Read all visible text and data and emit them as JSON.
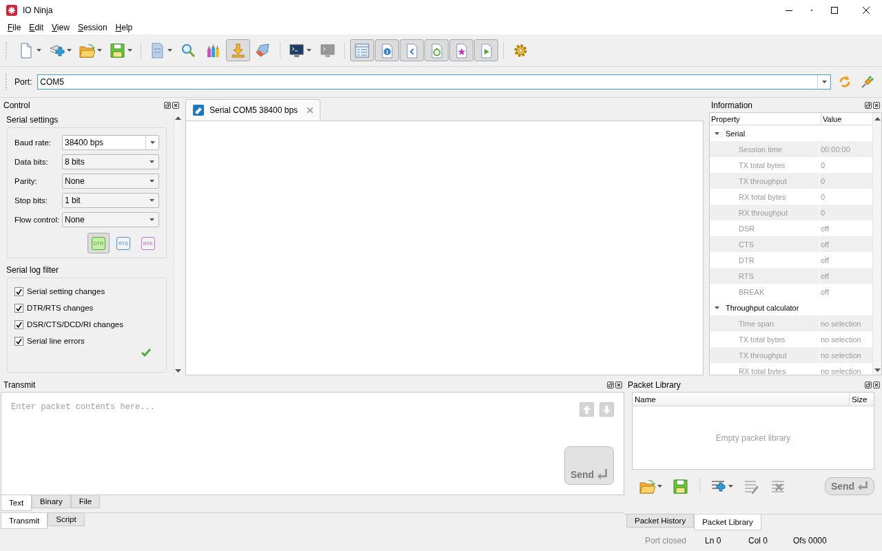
{
  "window": {
    "title": "IO Ninja"
  },
  "menu": [
    "File",
    "Edit",
    "View",
    "Session",
    "Help"
  ],
  "toolbar": [
    [
      {
        "dropdown": true,
        "pressed": false
      },
      {
        "dropdown": true,
        "pressed": false
      },
      {
        "dropdown": true,
        "pressed": false
      },
      {
        "dropdown": true,
        "pressed": false
      }
    ],
    [
      {
        "dropdown": true,
        "pressed": false
      },
      {
        "dropdown": false,
        "pressed": false
      },
      {
        "dropdown": false,
        "pressed": false
      },
      {
        "dropdown": false,
        "pressed": true
      },
      {
        "dropdown": false,
        "pressed": false
      }
    ],
    [
      {
        "dropdown": true,
        "pressed": false
      },
      {
        "dropdown": false,
        "pressed": false
      }
    ],
    [
      {
        "dropdown": false,
        "pressed": true
      },
      {
        "dropdown": false,
        "pressed": true
      },
      {
        "dropdown": false,
        "pressed": true
      },
      {
        "dropdown": false,
        "pressed": true
      },
      {
        "dropdown": false,
        "pressed": true
      },
      {
        "dropdown": false,
        "pressed": true
      }
    ],
    [
      {
        "dropdown": false,
        "pressed": false
      }
    ]
  ],
  "port": {
    "label": "Port:",
    "value": "COM5"
  },
  "control": {
    "title": "Control",
    "serial_settings": {
      "title": "Serial settings",
      "fields": [
        {
          "label": "Baud rate:",
          "value": "38400 bps",
          "kind": "editable"
        },
        {
          "label": "Data bits:",
          "value": "8 bits",
          "kind": "select"
        },
        {
          "label": "Parity:",
          "value": "None",
          "kind": "select"
        },
        {
          "label": "Stop bits:",
          "value": "1 bit",
          "kind": "select"
        },
        {
          "label": "Flow control:",
          "value": "None",
          "kind": "select"
        }
      ],
      "line_buttons": [
        {
          "label": "DTR",
          "pressed": true,
          "color": "#4caf1c"
        },
        {
          "label": "RTS",
          "pressed": false,
          "color": "#4a90d9"
        },
        {
          "label": "BRK",
          "pressed": false,
          "color": "#c470c8"
        }
      ]
    },
    "log_filter": {
      "title": "Serial log filter",
      "items": [
        {
          "label": "Serial setting changes",
          "checked": true
        },
        {
          "label": "DTR/RTS changes",
          "checked": true
        },
        {
          "label": "DSR/CTS/DCD/RI changes",
          "checked": true
        },
        {
          "label": "Serial line errors",
          "checked": true
        }
      ]
    }
  },
  "session_tabs": [
    {
      "label": "Serial COM5 38400 bps",
      "selected": true
    }
  ],
  "information": {
    "title": "Information",
    "columns": [
      "Property",
      "Value"
    ],
    "groups": [
      {
        "label": "Serial",
        "expanded": true,
        "children": [
          {
            "property": "Session time",
            "value": "00:00:00"
          },
          {
            "property": "TX total bytes",
            "value": "0"
          },
          {
            "property": "TX throughput",
            "value": "0"
          },
          {
            "property": "RX total bytes",
            "value": "0"
          },
          {
            "property": "RX throughput",
            "value": "0"
          },
          {
            "property": "DSR",
            "value": "off"
          },
          {
            "property": "CTS",
            "value": "off"
          },
          {
            "property": "DTR",
            "value": "off"
          },
          {
            "property": "RTS",
            "value": "off"
          },
          {
            "property": "BREAK",
            "value": "off"
          }
        ]
      },
      {
        "label": "Throughput calculator",
        "expanded": true,
        "children": [
          {
            "property": "Time span",
            "value": "no selection"
          },
          {
            "property": "TX total bytes",
            "value": "no selection"
          },
          {
            "property": "TX throughput",
            "value": "no selection"
          },
          {
            "property": "RX total bytes",
            "value": "no selection"
          }
        ]
      }
    ]
  },
  "transmit": {
    "title": "Transmit",
    "placeholder": "Enter packet contents here...",
    "send": "Send",
    "format_tabs": [
      {
        "label": "Text",
        "selected": true
      },
      {
        "label": "Binary",
        "selected": false
      },
      {
        "label": "File",
        "selected": false
      }
    ],
    "mode_tabs": [
      {
        "label": "Transmit",
        "selected": true
      },
      {
        "label": "Script",
        "selected": false
      }
    ]
  },
  "packet_library": {
    "title": "Packet Library",
    "columns": [
      "Name",
      "Size"
    ],
    "empty_text": "Empty packet library",
    "send": "Send",
    "tabs": [
      {
        "label": "Packet History",
        "selected": false
      },
      {
        "label": "Packet Library",
        "selected": true
      }
    ]
  },
  "status_bar": [
    {
      "text": "Port closed",
      "disabled": true
    },
    {
      "text": "Ln 0",
      "disabled": false
    },
    {
      "text": "Col 0",
      "disabled": false
    },
    {
      "text": "Ofs 0000",
      "disabled": false
    }
  ]
}
